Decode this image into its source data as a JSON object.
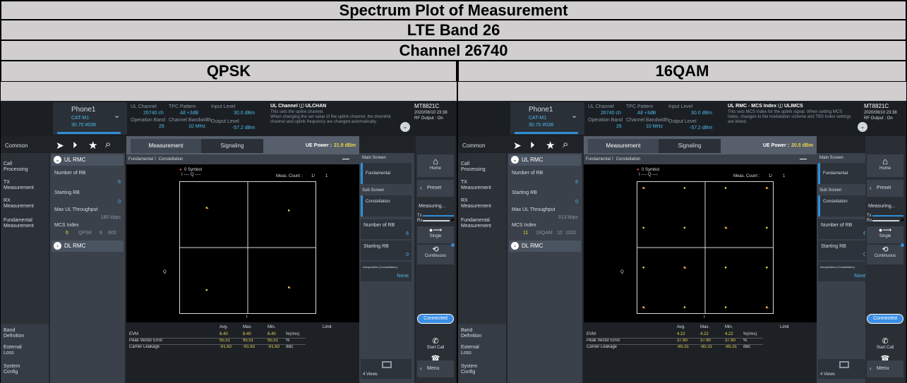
{
  "header": {
    "title": "Spectrum Plot of Measurement",
    "band": "LTE Band 26",
    "channel": "Channel 26740"
  },
  "columns": [
    {
      "modulation": "QPSK",
      "phone": {
        "name": "Phone1",
        "sub1": "CAT-M1",
        "sub2": "30.70 #038"
      },
      "status": {
        "ul_channel_label": "UL Channel",
        "ul_channel_value": "26740 ch",
        "tpc_label": "TPC Pattern",
        "tpc_value": "All +3dB",
        "input_label": "Input Level",
        "input_value": "30.0 dBm",
        "band_label": "Operation Band",
        "band_value": "26",
        "bw_label": "Channel Bandwidth",
        "bw_value": "10 MHz",
        "output_label": "Output Level",
        "output_value": "-57.2 dBm"
      },
      "help": {
        "title": "UL Channel ⓘ ULCHAN",
        "l1": "This sets the uplink channel.",
        "l2": "When changing the set value of the uplink channel, the downlink",
        "l3": "channel and uplink frequency are changed automatically."
      },
      "instrument": {
        "model": "MT8821C",
        "time": "2020/08/10 23:38",
        "output": "RF Output : On"
      },
      "nav": [
        "Common",
        "Call\nProcessing",
        "TX\nMeasurement",
        "RX\nMeasurement",
        "Fundamental\nMeasurement",
        "Band\nDefinition",
        "External\nLoss",
        "System\nConfig"
      ],
      "params": {
        "group": "UL RMC",
        "n_rb_label": "Number of RB",
        "n_rb_value": "6",
        "start_rb_label": "Starting RB",
        "start_rb_value": "0",
        "tput_label": "Max UL Throughput",
        "tput_value": "180 kbps",
        "mcs_label": "MCS Index",
        "mcs_value": "6",
        "mcs_mod": "QPSK",
        "mcs_a": "6",
        "mcs_b": "600",
        "group2": "DL RMC"
      },
      "tabs": {
        "measurement": "Measurement",
        "signaling": "Signaling"
      },
      "ue_power_label": "UE Power :",
      "ue_power_value": "21.9 dBm",
      "crumb": "Fundamental 〉Constellation",
      "plot": {
        "legend_a": "0 Symbol",
        "legend_b": "I ---- Q ----",
        "meas_count_label": "Meas. Count :",
        "meas_count_value": "1/",
        "meas_count_total": "1",
        "axis_q": "Q",
        "axis_i": "I"
      },
      "results": {
        "h_avg": "Avg.",
        "h_max": "Max.",
        "h_min": "Min.",
        "h_limit": "Limit",
        "rows": [
          {
            "name": "EVM",
            "avg": "8.40",
            "max": "8.40",
            "min": "8.40",
            "unit": "%(rms)"
          },
          {
            "name": "Peak Vector Error",
            "avg": "95.51",
            "max": "95.51",
            "min": "95.51",
            "unit": "%"
          },
          {
            "name": "Carrier Leakage",
            "avg": "-91.63",
            "max": "-91.63",
            "min": "-91.63",
            "unit": "dBc"
          }
        ]
      },
      "screens": {
        "main": "Main Screen",
        "fundamental": "Fundamental",
        "sub": "Sub Screen",
        "constellation": "Constellation",
        "n_rb": "Number of RB",
        "n_rb_val": "6",
        "start_rb": "Starting RB",
        "start_rb_val": "0",
        "interp": "Interpolation (Constellation)",
        "interp_val": "None",
        "views": "4 Views"
      },
      "side": {
        "home": "Home",
        "preset": "Preset",
        "measuring": "Measuring...",
        "tx": "Tx",
        "rx": "Rx",
        "single": "Single",
        "continuous": "Continuous",
        "connected": "Connected",
        "start_call": "Start Call",
        "end_call": "End Call",
        "menu": "Menu"
      },
      "constellation_points": [
        {
          "i": -0.3,
          "q": 0.3
        },
        {
          "i": 0.3,
          "q": 0.28
        },
        {
          "i": -0.3,
          "q": -0.32
        },
        {
          "i": 0.3,
          "q": -0.3
        }
      ]
    },
    {
      "modulation": "16QAM",
      "phone": {
        "name": "Phone1",
        "sub1": "CAT-M1",
        "sub2": "30.70 #038"
      },
      "status": {
        "ul_channel_label": "UL Channel",
        "ul_channel_value": "26740 ch",
        "tpc_label": "TPC Pattern",
        "tpc_value": "All +3dB",
        "input_label": "Input Level",
        "input_value": "30.0 dBm",
        "band_label": "Operation Band",
        "band_value": "26",
        "bw_label": "Channel Bandwidth",
        "bw_value": "10 MHz",
        "output_label": "Output Level",
        "output_value": "-57.2 dBm"
      },
      "help": {
        "title": "UL RMC - MCS Index ⓘ ULIMCS",
        "l1": "This sets MCS Index for the uplink signal. When setting MCS",
        "l2": "Index, changes to the modulation scheme and TBS Index settings",
        "l3": "are linked."
      },
      "instrument": {
        "model": "MT8821C",
        "time": "2020/08/10 23:38",
        "output": "RF Output : On"
      },
      "nav": [
        "Common",
        "Call\nProcessing",
        "TX\nMeasurement",
        "RX\nMeasurement",
        "Fundamental\nMeasurement",
        "Band\nDefinition",
        "External\nLoss",
        "System\nConfig"
      ],
      "params": {
        "group": "UL RMC",
        "n_rb_label": "Number of RB",
        "n_rb_value": "6",
        "start_rb_label": "Starting RB",
        "start_rb_value": "0",
        "tput_label": "Max UL Throughput",
        "tput_value": "313 kbps",
        "mcs_label": "MCS Index",
        "mcs_value": "11",
        "mcs_mod": "16QAM",
        "mcs_a": "10",
        "mcs_b": "1032",
        "group2": "DL RMC"
      },
      "tabs": {
        "measurement": "Measurement",
        "signaling": "Signaling"
      },
      "ue_power_label": "UE Power :",
      "ue_power_value": "20.5 dBm",
      "crumb": "Fundamental 〉Constellation",
      "plot": {
        "legend_a": "0 Symbol",
        "legend_b": "I ---- Q ----",
        "meas_count_label": "Meas. Count :",
        "meas_count_value": "1/",
        "meas_count_total": "1",
        "axis_q": "Q",
        "axis_i": "I"
      },
      "results": {
        "h_avg": "Avg.",
        "h_max": "Max.",
        "h_min": "Min.",
        "h_limit": "Limit",
        "rows": [
          {
            "name": "EVM",
            "avg": "4.22",
            "max": "4.22",
            "min": "4.22",
            "unit": "%(rms)"
          },
          {
            "name": "Peak Vector Error",
            "avg": "37.80",
            "max": "37.80",
            "min": "37.80",
            "unit": "%"
          },
          {
            "name": "Carrier Leakage",
            "avg": "-85.31",
            "max": "-85.31",
            "min": "-85.31",
            "unit": "dBc"
          }
        ]
      },
      "screens": {
        "main": "Main Screen",
        "fundamental": "Fundamental",
        "sub": "Sub Screen",
        "constellation": "Constellation",
        "n_rb": "Number of RB",
        "n_rb_val": "6",
        "start_rb": "Starting RB",
        "start_rb_val": "0",
        "interp": "Interpolation (Constellation)",
        "interp_val": "None",
        "views": "4 Views"
      },
      "side": {
        "home": "Home",
        "preset": "Preset",
        "measuring": "Measuring...",
        "tx": "Tx",
        "rx": "Rx",
        "single": "Single",
        "continuous": "Continuous",
        "connected": "Connected",
        "start_call": "Start Call",
        "end_call": "End Call",
        "menu": "Menu"
      },
      "constellation_points": [
        {
          "i": -0.45,
          "q": 0.45
        },
        {
          "i": -0.15,
          "q": 0.45
        },
        {
          "i": 0.15,
          "q": 0.45
        },
        {
          "i": 0.45,
          "q": 0.45
        },
        {
          "i": -0.45,
          "q": 0.15
        },
        {
          "i": -0.15,
          "q": 0.15
        },
        {
          "i": 0.15,
          "q": 0.15
        },
        {
          "i": 0.45,
          "q": 0.15
        },
        {
          "i": -0.45,
          "q": -0.15
        },
        {
          "i": -0.15,
          "q": -0.15
        },
        {
          "i": 0.15,
          "q": -0.15
        },
        {
          "i": 0.45,
          "q": -0.15
        },
        {
          "i": -0.45,
          "q": -0.45
        },
        {
          "i": -0.15,
          "q": -0.45
        },
        {
          "i": 0.15,
          "q": -0.45
        },
        {
          "i": 0.45,
          "q": -0.45
        }
      ]
    }
  ],
  "colors": {
    "header_bg": "#d0cece",
    "panel_bg": "#23272c",
    "accent": "#2f8fd8",
    "connected": "#3a8ee6",
    "yellow": "#e8d44d",
    "plot_bg": "#000000"
  }
}
